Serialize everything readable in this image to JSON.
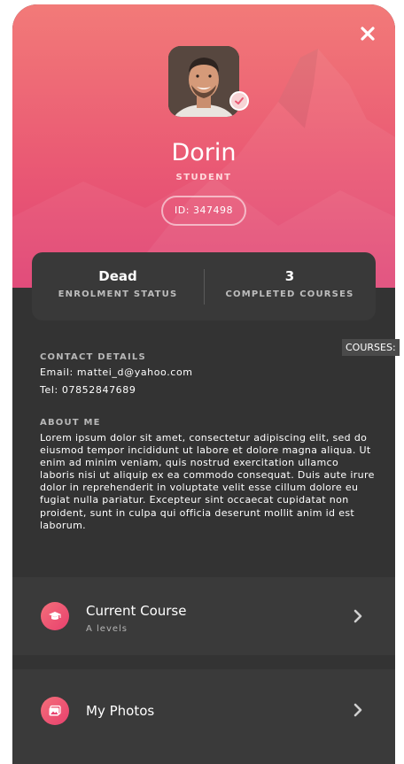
{
  "profile": {
    "name": "Dorin",
    "role": "STUDENT",
    "id_label": "ID: 347498",
    "close_icon": "close-icon",
    "verified_icon": "check-circle-icon"
  },
  "stats": {
    "enrolment_value": "Dead",
    "enrolment_label": "ENROLMENT STATUS",
    "courses_value": "3",
    "courses_label": "COMPLETED COURSES"
  },
  "tooltip": {
    "text": "COURSES:"
  },
  "contact": {
    "title": "CONTACT DETAILS",
    "email": "Email: mattei_d@yahoo.com",
    "tel": "Tel: 07852847689"
  },
  "about": {
    "title": "ABOUT ME",
    "text": "Lorem ipsum dolor sit amet, consectetur adipiscing elit, sed do eiusmod tempor incididunt ut labore et dolore magna aliqua. Ut enim ad minim veniam, quis nostrud exercitation ullamco laboris nisi ut aliquip ex ea commodo consequat. Duis aute irure dolor in reprehenderit in voluptate velit esse cillum dolore eu fugiat nulla pariatur. Excepteur sint occaecat cupidatat non proident, sunt in culpa qui officia deserunt mollit anim id est laborum."
  },
  "menu": {
    "items": [
      {
        "title": "Current Course",
        "subtitle": "A levels",
        "icon": "graduation-cap-icon"
      },
      {
        "title": "My Photos",
        "subtitle": "",
        "icon": "photos-icon"
      }
    ]
  },
  "colors": {
    "accent": "#ea5a74",
    "panel": "#333333",
    "card": "#3a3a3a"
  }
}
